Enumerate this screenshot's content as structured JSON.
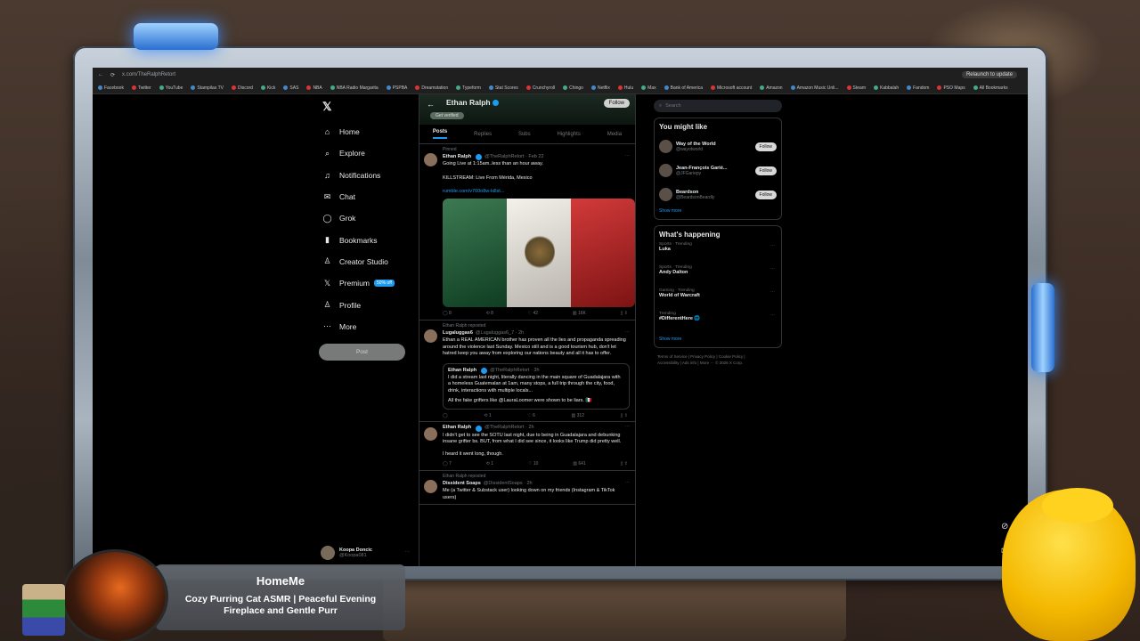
{
  "browser": {
    "url": "x.com/TheRalphRetort",
    "update_label": "Relaunch to update",
    "bookmarks": [
      "Facebook",
      "Twitter",
      "YouTube",
      "Stampilas TV",
      "Discord",
      "Kick",
      "SAS",
      "NBA",
      "NBA Radio Margarita",
      "PSPBA",
      "Dreamstation",
      "Typeform",
      "Stat Scores",
      "Crunchyroll",
      "Chingo",
      "Netflix",
      "Hulu",
      "Max",
      "Bank of America",
      "Microsoft account",
      "Amazon",
      "Amazon Music Unli...",
      "Steam",
      "Kabbalah",
      "Fandom",
      "PSO Maps",
      "All Bookmarks"
    ]
  },
  "nav": {
    "logo": "𝕏",
    "items": [
      {
        "label": "Home",
        "icon": "⌂"
      },
      {
        "label": "Explore",
        "icon": "⌕"
      },
      {
        "label": "Notifications",
        "icon": "♫"
      },
      {
        "label": "Chat",
        "icon": "✉"
      },
      {
        "label": "Grok",
        "icon": "◯"
      },
      {
        "label": "Bookmarks",
        "icon": "▮"
      },
      {
        "label": "Creator Studio",
        "icon": "♙"
      },
      {
        "label": "Premium",
        "icon": "𝕏"
      },
      {
        "label": "Profile",
        "icon": "♙"
      },
      {
        "label": "More",
        "icon": "⋯"
      }
    ],
    "premium_badge": "50% off",
    "post_label": "Post",
    "me_name": "Koopa Doncic",
    "me_handle": "@Koopa081",
    "me_more": "⋯"
  },
  "profile": {
    "name": "Ethan Ralph",
    "back": "←",
    "chip": "Get verified",
    "follow": "Follow",
    "tabs": [
      "Posts",
      "Replies",
      "Subs",
      "Highlights",
      "Media"
    ]
  },
  "tweets": [
    {
      "context": "Pinned",
      "name": "Ethan Ralph",
      "handle": "@TheRalphRetort · Feb 22",
      "text1": "Going Live at 1:15am..less than an hour away.",
      "text2": "KILLSTREAM: Live From Mérida, Mexico",
      "link": "rumble.com/v760o8w-killst...",
      "actions": [
        "8",
        "8",
        "42",
        "16K",
        ""
      ]
    },
    {
      "context": "Ethan Ralph reposted",
      "name": "Lugaluggas6",
      "handle": "@Lugaluggas6_7 · 2h",
      "text1": "Ethan a REAL AMERICAN brother has proven all the lies and propaganda spreading around the violence last Sunday. Mexico still and is a good tourism hub, don't let hatred keep you away from exploring our nations beauty and all it has to offer.",
      "quote_name": "Ethan Ralph",
      "quote_handle": "@TheRalphRetort · 3h",
      "quote_text": "I did a stream last night, literally dancing in the main square of Guadalajara with a homeless Guatemalan at 1am, many stops, a full trip through the city, food, drink, interactions with multiple locals...",
      "quote_text2": "All the fake grifters like @LauraLoomer were shown to be liars. 🇲🇽",
      "actions": [
        "",
        "1",
        "6",
        "312",
        ""
      ]
    },
    {
      "context": "",
      "name": "Ethan Ralph",
      "handle": "@TheRalphRetort · 2h",
      "text1": "I didn't get to see the SOTU last night, due to being in Guadalajara and debunking insane grifter bs. BUT, from what I did see since, it looks like Trump did pretty well.",
      "text2": "I heard it went long, though.",
      "actions": [
        "7",
        "1",
        "10",
        "641",
        ""
      ]
    },
    {
      "context": "Ethan Ralph reposted",
      "name": "Dissident Soaps",
      "handle": "@DissidentSoaps · 2h",
      "text1": "Me (a Twitter & Substack user) looking down on my friends (Instagram & TikTok users)"
    }
  ],
  "right": {
    "search_placeholder": "Search",
    "might_like_title": "You might like",
    "suggestions": [
      {
        "name": "Way of the World",
        "handle": "@wayotworld"
      },
      {
        "name": "Jean-François Garié...",
        "handle": "@JFGariepy"
      },
      {
        "name": "Beardson",
        "handle": "@BeardsonBeardly"
      }
    ],
    "follow_label": "Follow",
    "show_more": "Show more",
    "happening_title": "What's happening",
    "trends": [
      {
        "cat": "Sports · Trending",
        "title": "Luka"
      },
      {
        "cat": "Sports · Trending",
        "title": "Andy Dalton"
      },
      {
        "cat": "Gaming · Trending",
        "title": "World of Warcraft"
      },
      {
        "cat": "Trending",
        "title": "#DifferentHere 🌐"
      }
    ],
    "footer1": "Terms of Service | Privacy Policy | Cookie Policy |",
    "footer2": "Accessibility | Ads info | More ··· © 2026 X Corp."
  },
  "overlay": {
    "title": "HomeMe",
    "subtitle": "Cozy Purring Cat ASMR | Peaceful Evening Fireplace and Gentle Purr"
  },
  "colors": {
    "accent": "#1d9bf0",
    "background": "#000000",
    "frame_glow": "#3a8cff"
  }
}
